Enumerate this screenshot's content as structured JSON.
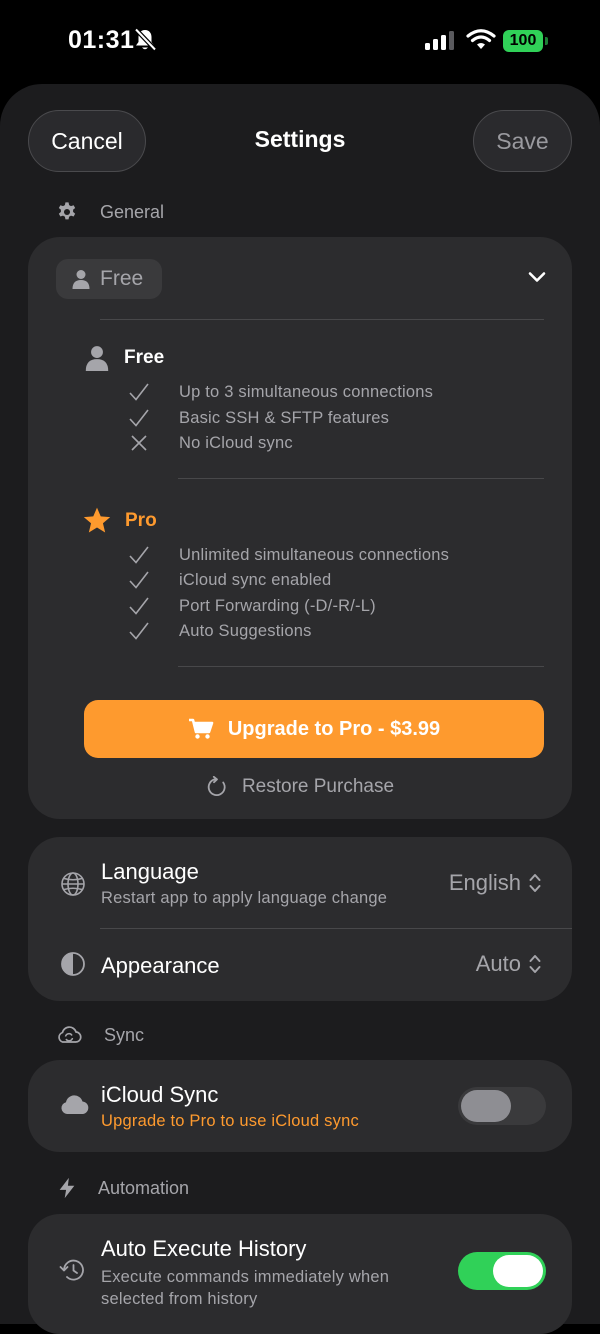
{
  "status_bar": {
    "time": "01:31",
    "battery": "100",
    "icons": [
      "bell-slash-icon",
      "cellular-signal-icon",
      "wifi-icon",
      "battery-icon"
    ]
  },
  "nav": {
    "cancel_label": "Cancel",
    "title": "Settings",
    "save_label": "Save"
  },
  "sections": {
    "general": "General",
    "sync": "Sync",
    "automation": "Automation"
  },
  "plan": {
    "selected": "Free",
    "free": {
      "title": "Free",
      "features": [
        {
          "text": "Up to 3 simultaneous connections",
          "included": true
        },
        {
          "text": "Basic SSH & SFTP features",
          "included": true
        },
        {
          "text": "No iCloud sync",
          "included": false
        }
      ]
    },
    "pro": {
      "title": "Pro",
      "features": [
        {
          "text": "Unlimited simultaneous connections",
          "included": true
        },
        {
          "text": "iCloud sync enabled",
          "included": true
        },
        {
          "text": "Port Forwarding (-D/-R/-L)",
          "included": true
        },
        {
          "text": "Auto Suggestions",
          "included": true
        }
      ]
    },
    "upgrade_label": "Upgrade to Pro - $3.99",
    "restore_label": "Restore Purchase"
  },
  "language": {
    "title": "Language",
    "subtitle": "Restart app to apply language change",
    "value": "English"
  },
  "appearance": {
    "title": "Appearance",
    "value": "Auto"
  },
  "icloud_sync": {
    "title": "iCloud Sync",
    "subtitle": "Upgrade to Pro to use iCloud sync",
    "enabled": false
  },
  "auto_execute": {
    "title": "Auto Execute History",
    "subtitle": "Execute commands immediately when selected from history",
    "enabled": true
  },
  "colors": {
    "accent_orange": "#fe9a2e",
    "toggle_on": "#30d158",
    "card_bg": "#2c2c2e",
    "sheet_bg": "#1c1c1e"
  }
}
